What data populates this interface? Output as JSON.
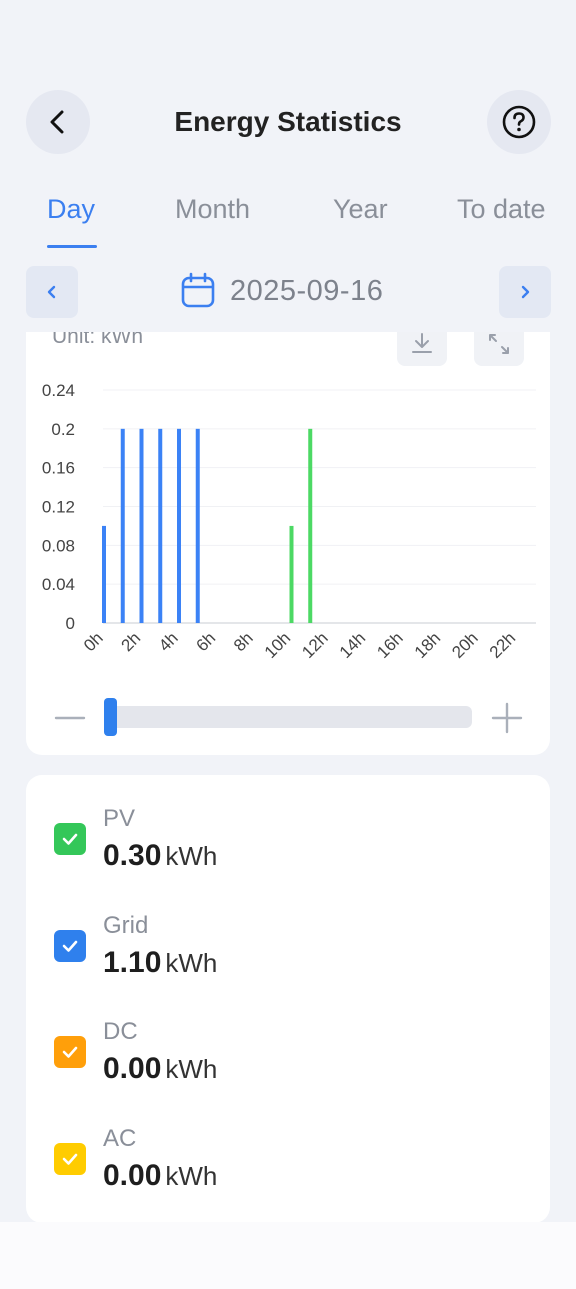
{
  "header": {
    "title": "Energy Statistics",
    "back_icon": "chevron-left-icon",
    "help_icon": "question-circle-icon"
  },
  "tabs": [
    {
      "label": "Day",
      "active": true
    },
    {
      "label": "Month",
      "active": false
    },
    {
      "label": "Year",
      "active": false
    },
    {
      "label": "To date",
      "active": false
    }
  ],
  "date_nav": {
    "date": "2025-09-16",
    "calendar_icon": "calendar-icon",
    "prev_icon": "chevron-left-icon",
    "next_icon": "chevron-right-icon"
  },
  "chart_toolbar": {
    "unit_label": "Unit: kWh",
    "download_icon": "download-icon",
    "fullscreen_icon": "expand-icon"
  },
  "chart_data": {
    "type": "bar",
    "x": [
      0,
      1,
      2,
      3,
      4,
      5,
      10,
      11
    ],
    "xticks": [
      "0h",
      "2h",
      "4h",
      "6h",
      "8h",
      "10h",
      "12h",
      "14h",
      "16h",
      "18h",
      "20h",
      "22h"
    ],
    "yticks": [
      "0",
      "0.04",
      "0.08",
      "0.12",
      "0.16",
      "0.2",
      "0.24"
    ],
    "ylim": [
      0,
      0.24
    ],
    "series": [
      {
        "color": "#3b82f6",
        "points": [
          [
            0,
            0.1
          ],
          [
            1,
            0.2
          ],
          [
            2,
            0.2
          ],
          [
            3,
            0.2
          ],
          [
            4,
            0.2
          ],
          [
            5,
            0.2
          ]
        ]
      },
      {
        "color": "#4cd964",
        "points": [
          [
            10,
            0.1
          ],
          [
            11,
            0.2
          ]
        ]
      }
    ],
    "grid": true
  },
  "zoom": {
    "minus_icon": "minus-icon",
    "plus_icon": "plus-icon",
    "slider_value": 0
  },
  "legend": [
    {
      "name": "PV",
      "value": "0.30",
      "unit": "kWh",
      "color": "#34c759",
      "checked": true
    },
    {
      "name": "Grid",
      "value": "1.10",
      "unit": "kWh",
      "color": "#2f80ed",
      "checked": true
    },
    {
      "name": "DC",
      "value": "0.00",
      "unit": "kWh",
      "color": "#ff9f0a",
      "checked": true
    },
    {
      "name": "AC",
      "value": "0.00",
      "unit": "kWh",
      "color": "#ffcc00",
      "checked": true
    }
  ]
}
